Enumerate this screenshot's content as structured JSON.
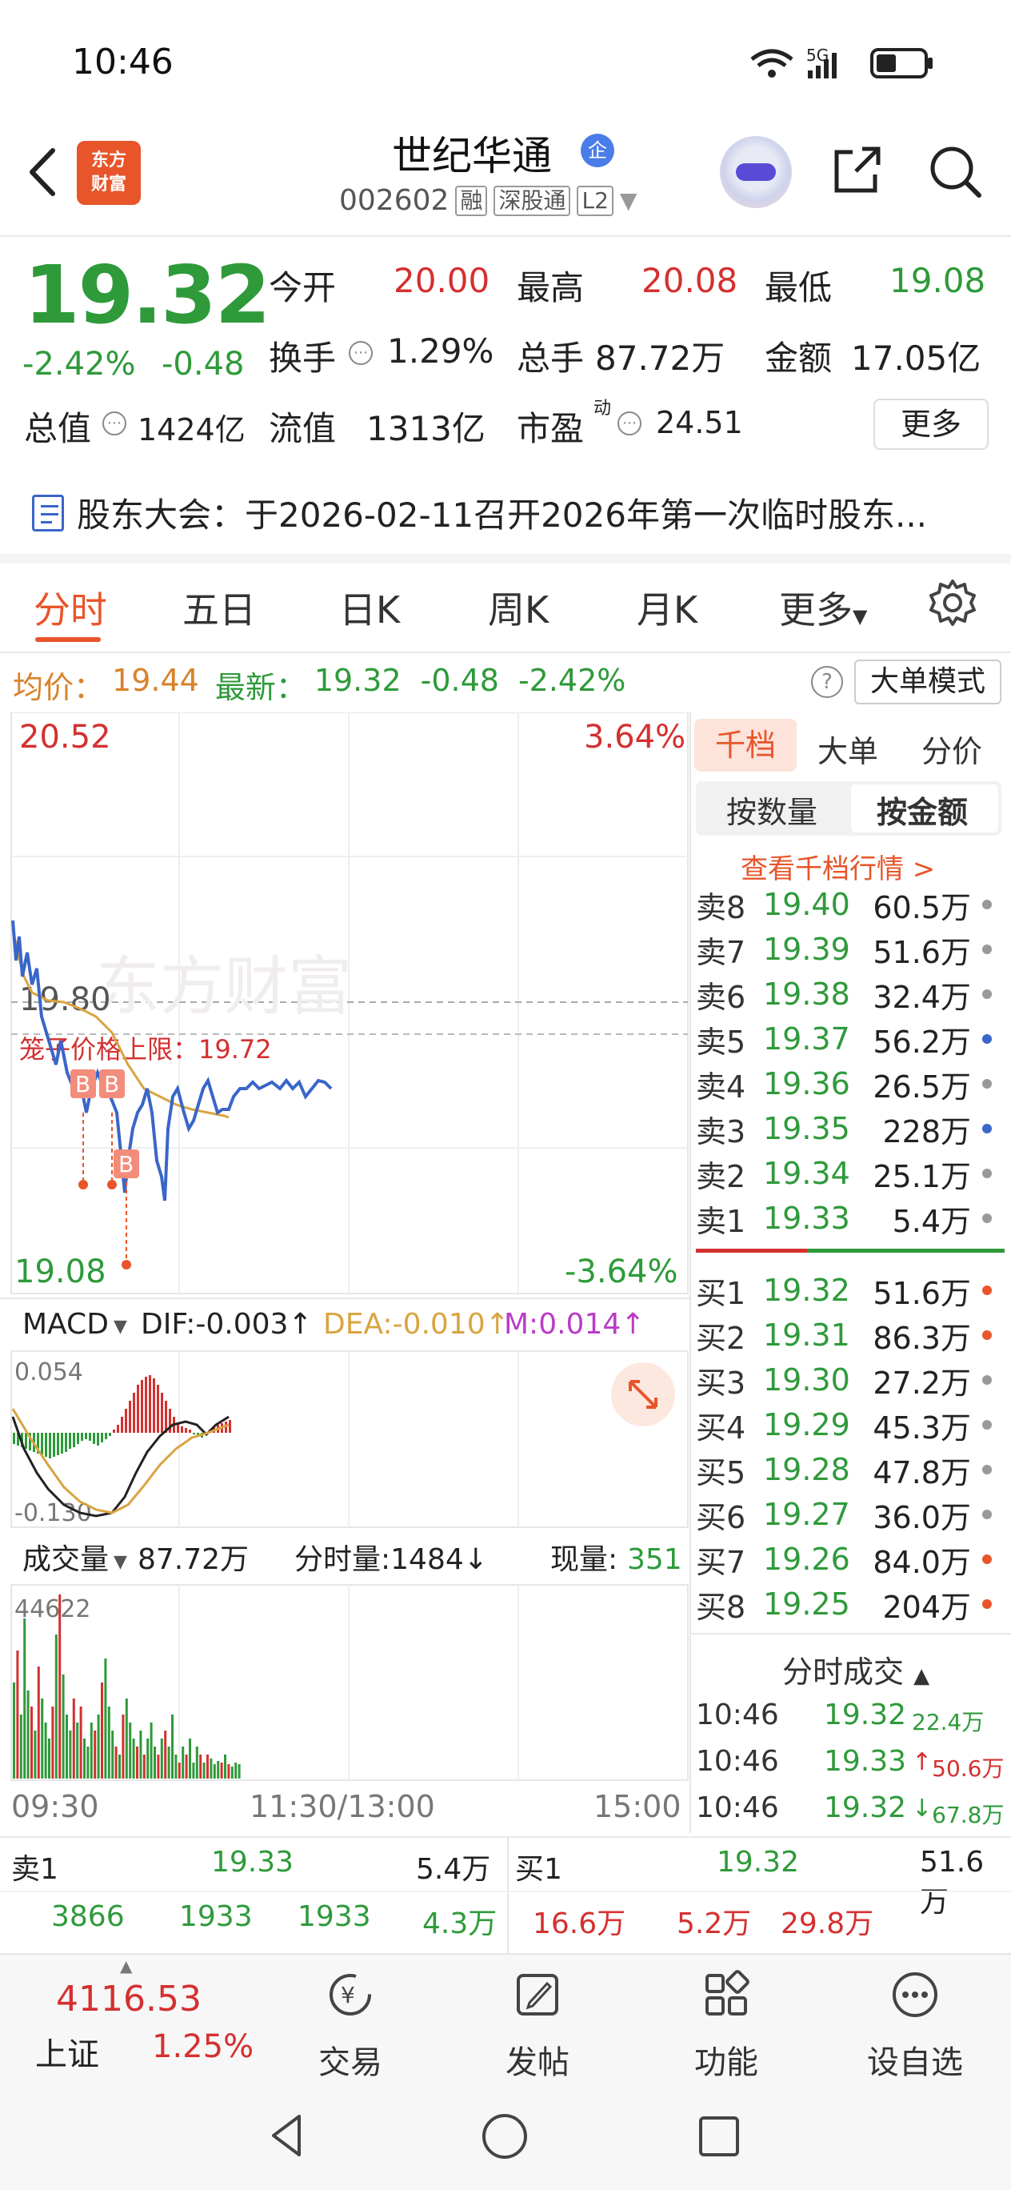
{
  "status_bar": {
    "time": "10:46",
    "network": "5G"
  },
  "header": {
    "logo_text_1": "东方",
    "logo_text_2": "财富",
    "stock_name": "世纪华通",
    "enterprise_badge": "企",
    "stock_code": "002602",
    "tags": [
      "融",
      "深股通",
      "L2"
    ]
  },
  "quote": {
    "price": "19.32",
    "change_pct": "-2.42%",
    "change": "-0.48",
    "open_label": "今开",
    "open": "20.00",
    "high_label": "最高",
    "high": "20.08",
    "low_label": "最低",
    "low": "19.08",
    "turnover_label": "换手",
    "turnover": "1.29%",
    "volume_label": "总手",
    "volume": "87.72万",
    "amount_label": "金额",
    "amount": "17.05亿",
    "market_cap_label": "总值",
    "market_cap": "1424亿",
    "float_cap_label": "流值",
    "float_cap": "1313亿",
    "pe_label": "市盈",
    "pe_sup": "动",
    "pe": "24.51",
    "more_label": "更多"
  },
  "notice": {
    "text": "股东大会：于2026-02-11召开2026年第一次临时股东..."
  },
  "tabs": [
    "分时",
    "五日",
    "日K",
    "周K",
    "月K",
    "更多"
  ],
  "avg_row": {
    "avg_label": "均价：",
    "avg": "19.44",
    "latest_label": "最新：",
    "latest": "19.32",
    "chg": "-0.48",
    "pct": "-2.42%",
    "big_order_mode": "大单模式"
  },
  "intraday": {
    "y_top": "20.52",
    "y_bottom": "19.08",
    "pct_top": "3.64%",
    "pct_bottom": "-3.64%",
    "ref_price": "19.80",
    "limit_label": "笼子价格上限：19.72",
    "watermark": "东方财富",
    "markers": [
      "B",
      "B",
      "B"
    ],
    "time_start": "09:30",
    "time_mid": "11:30/13:00",
    "time_end": "15:00"
  },
  "macd": {
    "name": "MACD",
    "dif": "DIF:-0.003↑",
    "dea": "DEA:-0.010↑",
    "m": "M:0.014↑",
    "top": "0.054",
    "bottom": "-0.130"
  },
  "volume_panel": {
    "label": "成交量",
    "total": "87.72万",
    "minute_vol": "分时量:1484↓",
    "current_label": "现量:",
    "current": "351",
    "top": "44622"
  },
  "order_book": {
    "tabs": [
      "千档",
      "大单",
      "分价"
    ],
    "seg": [
      "按数量",
      "按金额"
    ],
    "view_depth": "查看千档行情 >",
    "asks": [
      {
        "label": "卖8",
        "price": "19.40",
        "vol": "60.5万",
        "dot": "#999"
      },
      {
        "label": "卖7",
        "price": "19.39",
        "vol": "51.6万",
        "dot": "#999"
      },
      {
        "label": "卖6",
        "price": "19.38",
        "vol": "32.4万",
        "dot": "#999"
      },
      {
        "label": "卖5",
        "price": "19.37",
        "vol": "56.2万",
        "dot": "#3a66c8"
      },
      {
        "label": "卖4",
        "price": "19.36",
        "vol": "26.5万",
        "dot": "#999"
      },
      {
        "label": "卖3",
        "price": "19.35",
        "vol": "228万",
        "dot": "#3a66c8"
      },
      {
        "label": "卖2",
        "price": "19.34",
        "vol": "25.1万",
        "dot": "#999"
      },
      {
        "label": "卖1",
        "price": "19.33",
        "vol": "5.4万",
        "dot": "#999"
      }
    ],
    "bids": [
      {
        "label": "买1",
        "price": "19.32",
        "vol": "51.6万",
        "dot": "#e8552a"
      },
      {
        "label": "买2",
        "price": "19.31",
        "vol": "86.3万",
        "dot": "#e8552a"
      },
      {
        "label": "买3",
        "price": "19.30",
        "vol": "27.2万",
        "dot": "#999"
      },
      {
        "label": "买4",
        "price": "19.29",
        "vol": "45.3万",
        "dot": "#999"
      },
      {
        "label": "买5",
        "price": "19.28",
        "vol": "47.8万",
        "dot": "#999"
      },
      {
        "label": "买6",
        "price": "19.27",
        "vol": "36.0万",
        "dot": "#999"
      },
      {
        "label": "买7",
        "price": "19.26",
        "vol": "84.0万",
        "dot": "#e8552a"
      },
      {
        "label": "买8",
        "price": "19.25",
        "vol": "204万",
        "dot": "#e8552a"
      }
    ]
  },
  "time_sales": {
    "title": "分时成交",
    "rows": [
      {
        "time": "10:46",
        "price": "19.32",
        "vol": "22.4万",
        "color": "green"
      },
      {
        "time": "10:46",
        "price": "19.33",
        "arrow": "↑",
        "vol": "50.6万",
        "color": "green",
        "volcolor": "red"
      },
      {
        "time": "10:46",
        "price": "19.32",
        "arrow": "↓",
        "vol": "67.8万",
        "color": "green",
        "volcolor": "green"
      }
    ]
  },
  "bottom_quote": {
    "sell_label": "卖1",
    "sell_price": "19.33",
    "sell_vol": "5.4万",
    "buy_label": "买1",
    "buy_price": "19.32",
    "buy_vol": "51.6万",
    "sell_row": [
      "3866",
      "1933",
      "1933",
      "4.3万"
    ],
    "buy_row": [
      "16.6万",
      "5.2万",
      "29.8万"
    ]
  },
  "bottom_nav": {
    "index_value": "4116.53",
    "index_name": "上证",
    "index_pct": "1.25%",
    "items": [
      "交易",
      "发帖",
      "功能",
      "设自选"
    ]
  },
  "colors": {
    "up": "#d43030",
    "down": "#2e9a3a",
    "accent": "#e8552a",
    "avg": "#d9a441",
    "price_line": "#3a66c8"
  }
}
